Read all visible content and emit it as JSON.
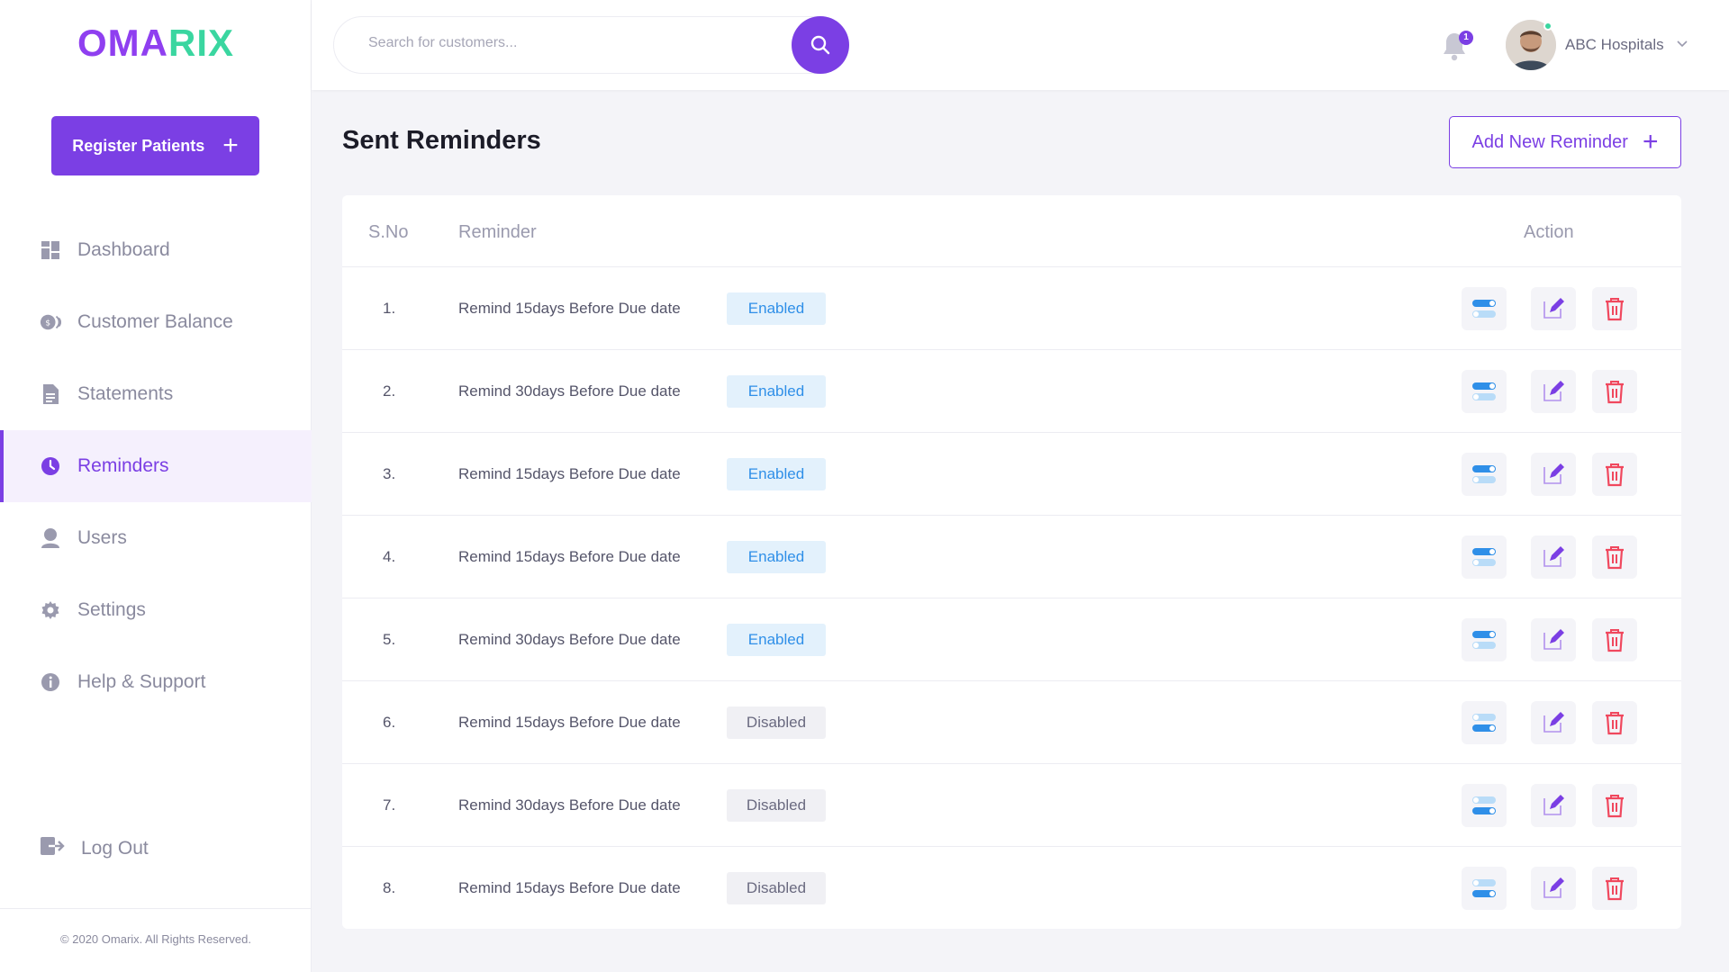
{
  "brand": {
    "part1": "OMA",
    "part2": "RIX"
  },
  "sidebar": {
    "register_label": "Register Patients",
    "items": [
      {
        "label": "Dashboard",
        "icon": "dashboard-icon"
      },
      {
        "label": "Customer Balance",
        "icon": "coins-icon"
      },
      {
        "label": "Statements",
        "icon": "document-icon"
      },
      {
        "label": "Reminders",
        "icon": "clock-icon",
        "active": true
      },
      {
        "label": "Users",
        "icon": "user-icon"
      },
      {
        "label": "Settings",
        "icon": "gear-icon"
      },
      {
        "label": "Help & Support",
        "icon": "info-icon"
      }
    ],
    "logout_label": "Log Out",
    "copyright": "© 2020 Omarix. All Rights Reserved."
  },
  "topbar": {
    "search_placeholder": "Search for customers...",
    "notification_count": "1",
    "account_name": "ABC Hospitals"
  },
  "main": {
    "title": "Sent Reminders",
    "add_label": "Add New Reminder",
    "columns": {
      "sno": "S.No",
      "reminder": "Reminder",
      "action": "Action"
    },
    "rows": [
      {
        "no": "1.",
        "text": "Remind 15days Before Due date",
        "status": "Enabled"
      },
      {
        "no": "2.",
        "text": "Remind 30days Before Due date",
        "status": "Enabled"
      },
      {
        "no": "3.",
        "text": "Remind 15days Before Due date",
        "status": "Enabled"
      },
      {
        "no": "4.",
        "text": "Remind 15days Before Due date",
        "status": "Enabled"
      },
      {
        "no": "5.",
        "text": "Remind 30days Before Due date",
        "status": "Enabled"
      },
      {
        "no": "6.",
        "text": "Remind 15days Before Due date",
        "status": "Disabled"
      },
      {
        "no": "7.",
        "text": "Remind 30days Before Due date",
        "status": "Disabled"
      },
      {
        "no": "8.",
        "text": "Remind 15days Before Due date",
        "status": "Disabled"
      }
    ]
  },
  "colors": {
    "accent": "#7b3fe4",
    "brand_green": "#3ad6a0",
    "enabled": "#2f8fe8",
    "danger": "#f0485e"
  }
}
